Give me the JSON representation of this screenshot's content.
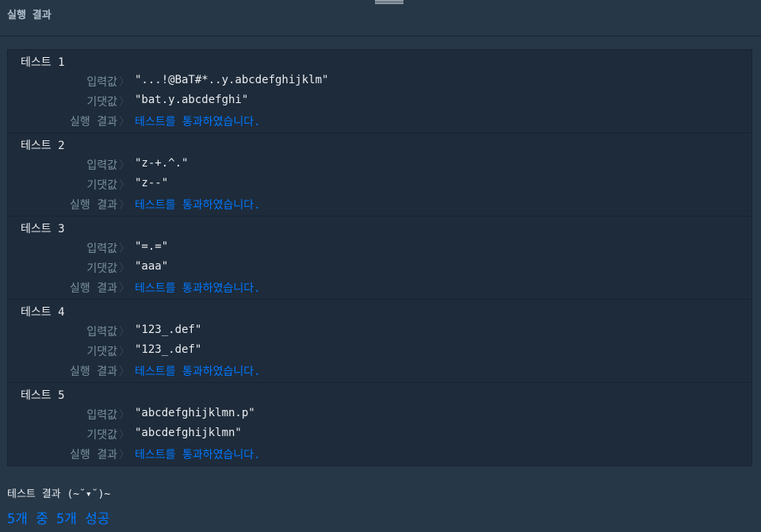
{
  "header": {
    "title": "실행 결과"
  },
  "labels": {
    "input": "입력값",
    "expected": "기댓값",
    "result": "실행 결과",
    "chevron": "〉"
  },
  "tests": [
    {
      "title": "테스트 1",
      "input": "\"...!@BaT#*..y.abcdefghijklm\"",
      "expected": "\"bat.y.abcdefghi\"",
      "result": "테스트를 통과하였습니다."
    },
    {
      "title": "테스트 2",
      "input": "\"z-+.^.\"",
      "expected": "\"z--\"",
      "result": "테스트를 통과하였습니다."
    },
    {
      "title": "테스트 3",
      "input": "\"=.=\"",
      "expected": "\"aaa\"",
      "result": "테스트를 통과하였습니다."
    },
    {
      "title": "테스트 4",
      "input": "\"123_.def\"",
      "expected": "\"123_.def\"",
      "result": "테스트를 통과하였습니다."
    },
    {
      "title": "테스트 5",
      "input": "\"abcdefghijklmn.p\"",
      "expected": "\"abcdefghijklmn\"",
      "result": "테스트를 통과하였습니다."
    }
  ],
  "summary": {
    "title": "테스트 결과 (~˘▾˘)~",
    "score": "5개 중 5개 성공"
  },
  "colors": {
    "background": "#263747",
    "panel": "#1e2b3a",
    "pass": "#0078ff",
    "label": "#78909c"
  }
}
